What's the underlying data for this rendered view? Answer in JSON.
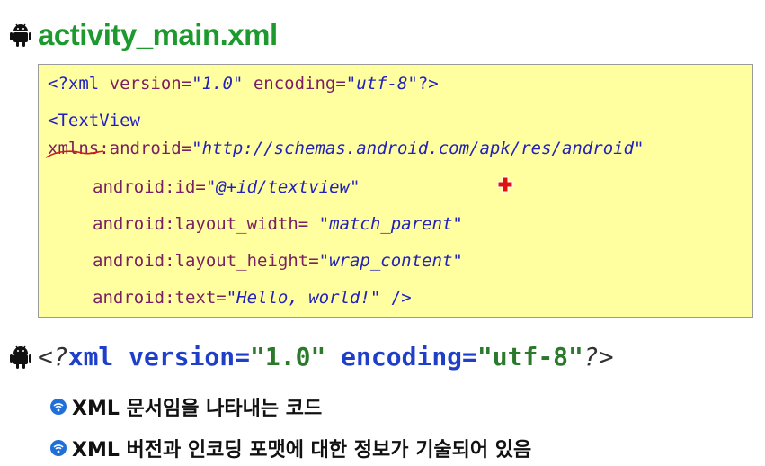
{
  "title": {
    "icon": "android-icon",
    "text": "activity_main.xml",
    "color": "#1c9a2e"
  },
  "code": {
    "background": "#ffff9f",
    "line1": {
      "open": "<?xml ",
      "attr1": "version",
      "eq1": "=",
      "val1": "\"1.0\"",
      "attr2": " encoding",
      "eq2": "=",
      "val2": "\"utf-8\"",
      "close": "?>"
    },
    "line2": {
      "tag": "<TextView"
    },
    "line3": {
      "prefix": "xmlns",
      "attr": ":android",
      "eq": "=",
      "val": "\"http://schemas.android.com/apk/res/android\""
    },
    "line4": {
      "attr": "android:id",
      "eq": "=",
      "val": "\"@+id/textview\""
    },
    "line5": {
      "attr": "android:layout_width",
      "eq": "= ",
      "val": "\"match_parent\""
    },
    "line6": {
      "attr": "android:layout_height",
      "eq": "=",
      "val": "\"wrap_content\""
    },
    "line7": {
      "attr": "android:text",
      "eq": "=",
      "val": "\"Hello, world!\"",
      "close": " />"
    }
  },
  "cursor": {
    "icon": "red-cross-cursor-icon"
  },
  "bullet": {
    "icon": "android-icon",
    "pi_open": "<?",
    "kw1": "xml version",
    "eq1": "=",
    "val1": "\"1.0\"",
    "kw2": " encoding",
    "eq2": "=",
    "val2": "\"utf-8\"",
    "pi_close": "?>"
  },
  "sub_items": [
    {
      "icon": "wifi-bullet-icon",
      "text": "XML 문서임을 나타내는 코드"
    },
    {
      "icon": "wifi-bullet-icon",
      "text": "XML 버전과 인코딩 포맷에 대한 정보가 기술되어 있음"
    }
  ]
}
